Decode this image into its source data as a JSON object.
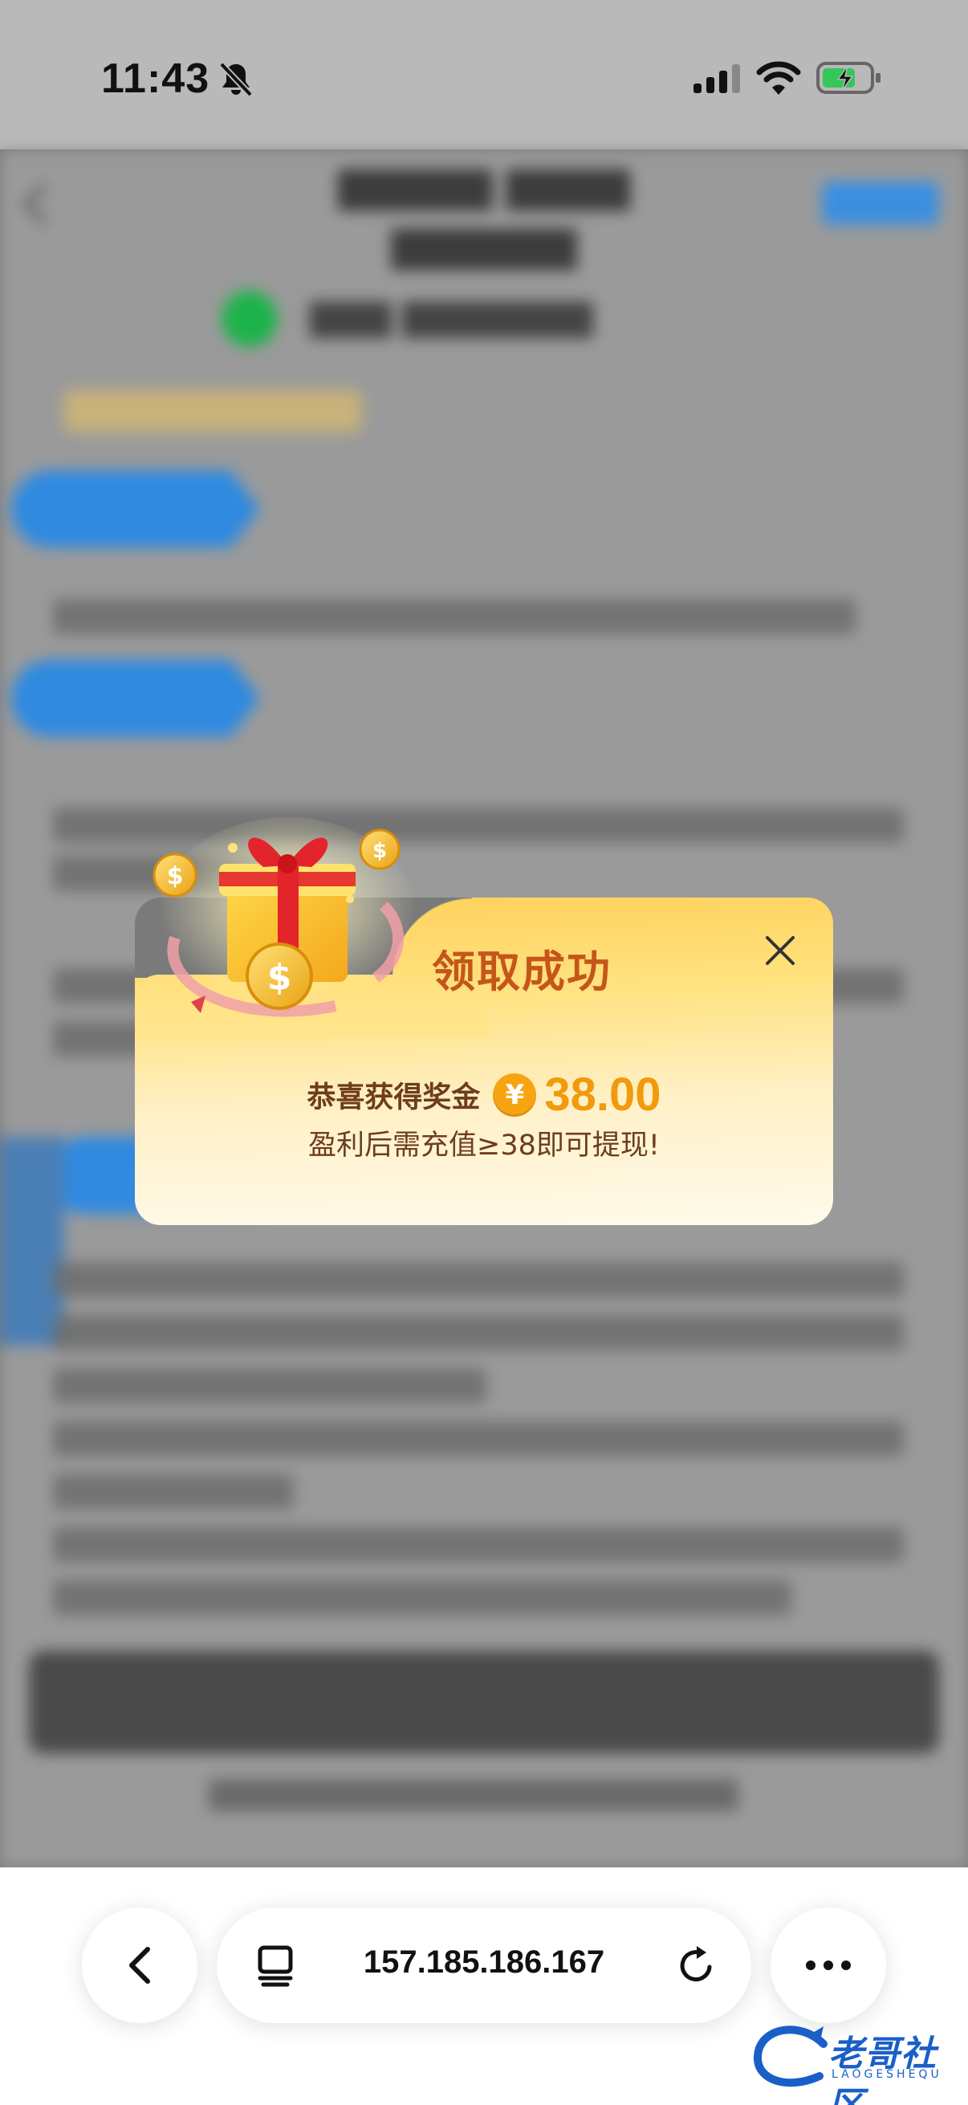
{
  "status_bar": {
    "time": "11:43"
  },
  "popup": {
    "title": "领取成功",
    "reward_label": "恭喜获得奖金",
    "currency_symbol": "¥",
    "amount": "38.00",
    "note": "盈利后需充值≥38即可提现!"
  },
  "browser": {
    "url": "157.185.186.167"
  },
  "watermark": {
    "text": "老哥社区",
    "subtext": "LAOGESHEQU"
  },
  "colors": {
    "title": "#c5561a",
    "amount": "#f29a0c",
    "reward_text": "#6d3d1d",
    "card_top": "#ffd15c",
    "card_bottom": "#fffaeb"
  }
}
